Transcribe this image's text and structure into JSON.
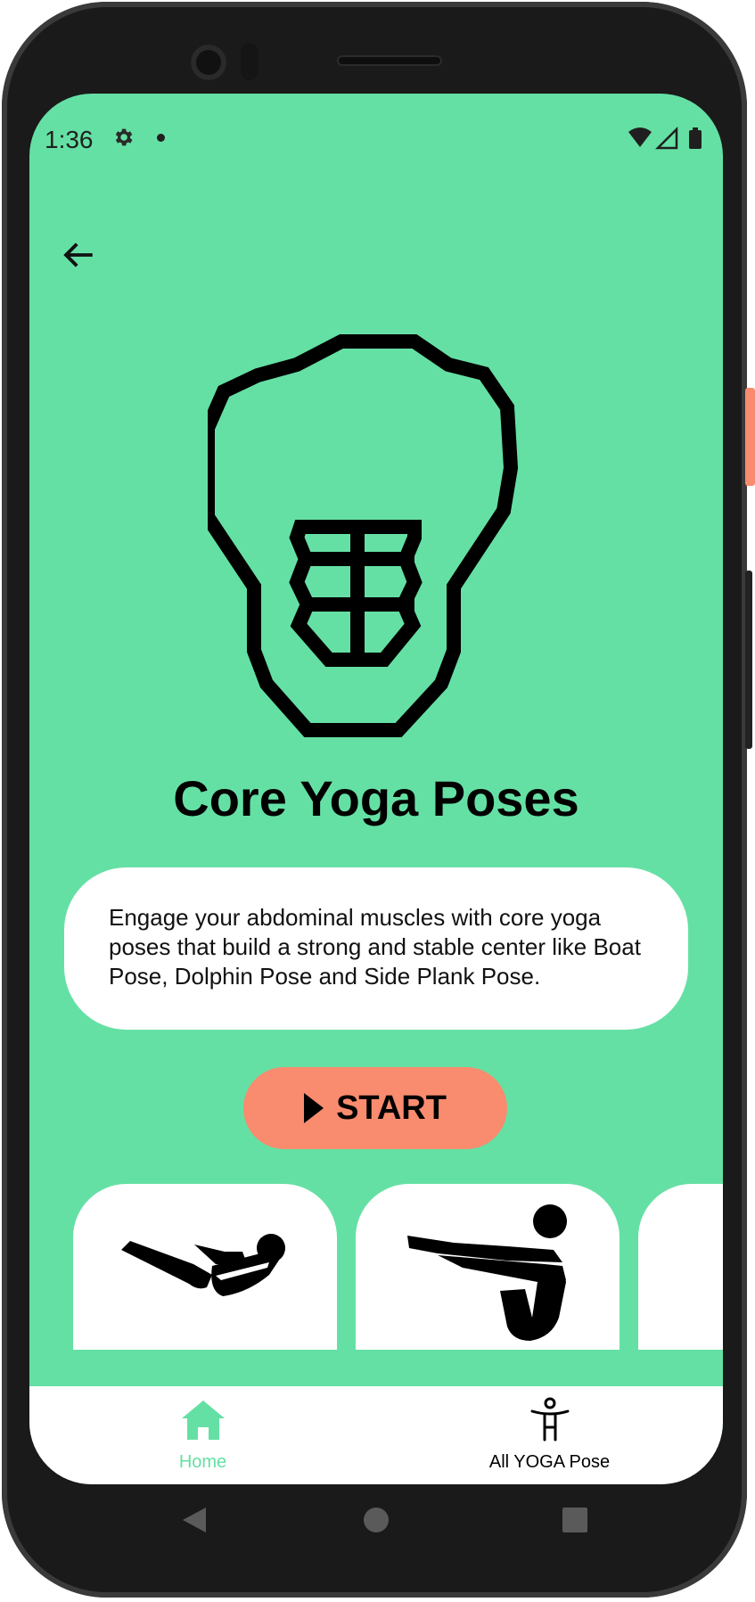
{
  "status_bar": {
    "time": "1:36"
  },
  "page": {
    "title": "Core Yoga Poses",
    "description": "Engage your abdominal muscles with core yoga poses that build a strong and stable center like Boat Pose, Dolphin Pose and Side Plank Pose.",
    "start_label": "START"
  },
  "bottom_nav": {
    "items": [
      {
        "label": "Home",
        "icon": "home-icon",
        "active": true
      },
      {
        "label": "All YOGA Pose",
        "icon": "person-icon",
        "active": false
      }
    ]
  },
  "colors": {
    "background": "#65E0A4",
    "accent_button": "#F98B6E",
    "nav_active": "#65E0A4",
    "card": "#FFFFFF",
    "text": "#000000"
  }
}
